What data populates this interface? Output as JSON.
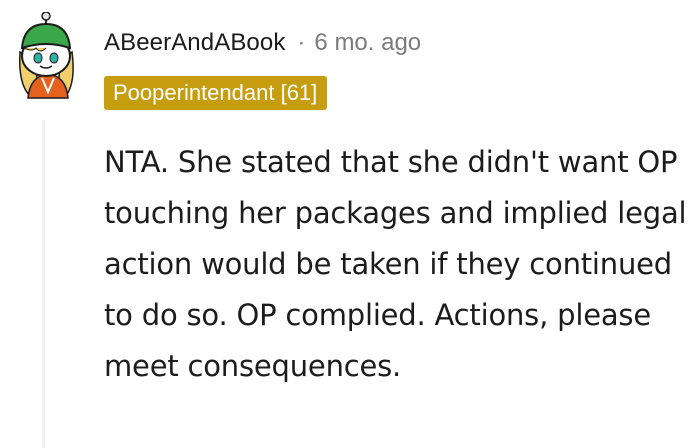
{
  "comment": {
    "author": "ABeerAndABook",
    "separator": "·",
    "time_ago": "6 mo. ago",
    "flair": "Pooperintendant [61]",
    "flair_color": "#c59d0e",
    "body": "NTA. She stated that she didn't want OP touching her packages and implied legal action would be taken if they continued to do so. OP complied. Actions, please meet consequences.",
    "avatar_icon": "snoo-avatar-icon",
    "avatar_colors": {
      "beanie": "#3aa84a",
      "hair": "#f2d06b",
      "outfit": "#e5611e"
    }
  }
}
